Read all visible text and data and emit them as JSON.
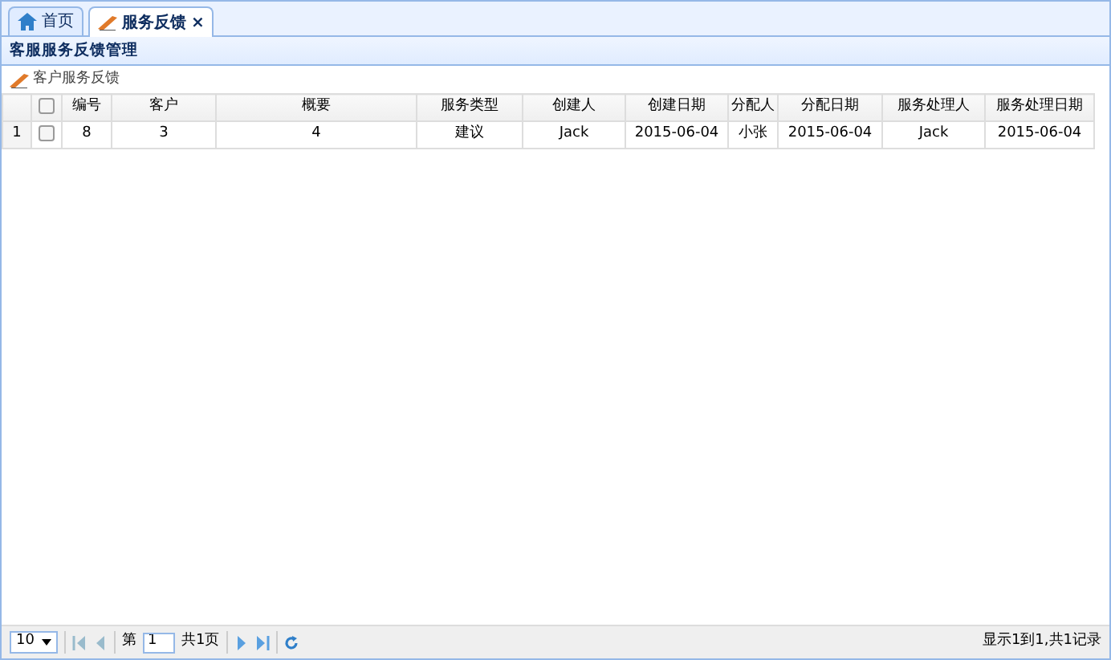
{
  "tabs": [
    {
      "label": "首页",
      "kind": "home",
      "selected": false
    },
    {
      "label": "服务反馈",
      "kind": "module",
      "selected": true,
      "close": "×"
    }
  ],
  "panel": {
    "title": "客服服务反馈管理"
  },
  "toolbar": {
    "button": "客户服务反馈"
  },
  "table": {
    "header_checked": false,
    "columns": [
      "编号",
      "客户",
      "概要",
      "服务类型",
      "创建人",
      "创建日期",
      "分配人",
      "分配日期",
      "服务处理人",
      "服务处理日期"
    ],
    "rows": [
      {
        "row_number": "1",
        "checked": false,
        "cells": [
          "8",
          "3",
          "4",
          "建议",
          "Jack",
          "2015-06-04",
          "小张",
          "2015-06-04",
          "Jack",
          "2015-06-04"
        ]
      }
    ]
  },
  "pager": {
    "page_size": "10",
    "page_prefix": "第",
    "page_value": "1",
    "page_total": "共1页",
    "summary": "显示1到1,共1记录"
  }
}
